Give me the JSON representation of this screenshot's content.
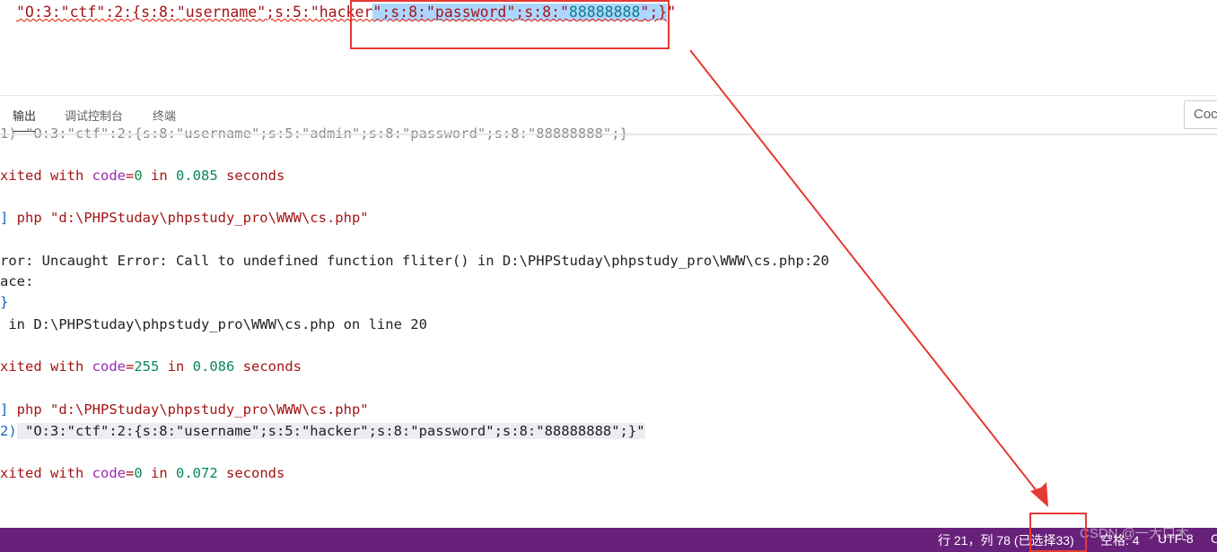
{
  "editor": {
    "line_prefix": "\"O:3:\"ctf\":2:{s:8:\"username\";s:5:\"hacker",
    "line_sel_a": "\";s:8:\"password\";s:8:\"",
    "line_sel_b": "88888888",
    "line_sel_c": "\";}",
    "line_end": "\""
  },
  "panel": {
    "tabs": [
      "输出",
      "调试控制台",
      "终端"
    ],
    "active_tab": "输出",
    "output_select_label": "Coc"
  },
  "output": {
    "lines": [
      "1) \"O:3:\"ctf\":2:{s:8:\"username\";s:5:\"admin\";s:8:\"password\";s:8:\"88888888\";}",
      "xited with code=0 in 0.085 seconds",
      "] php \"d:\\PHPStuday\\phpstudy_pro\\WWW\\cs.php\"",
      "ror: Uncaught Error: Call to undefined function fliter() in D:\\PHPStuday\\phpstudy_pro\\WWW\\cs.php:20",
      "ace:",
      "}",
      " in D:\\PHPStuday\\phpstudy_pro\\WWW\\cs.php on line 20",
      "xited with code=255 in 0.086 seconds",
      "] php \"d:\\PHPStuday\\phpstudy_pro\\WWW\\cs.php\"",
      "2) \"O:3:\"ctf\":2:{s:8:\"username\";s:5:\"hacker\";s:8:\"password\";s:8:\"88888888\";}\"",
      "xited with code=0 in 0.072 seconds"
    ],
    "exit_parts": [
      {
        "a": "xited with ",
        "b": "code",
        "c": "=",
        "d": "0",
        "e": " in ",
        "f": "0.085",
        "g": " seconds"
      },
      {
        "a": "xited with ",
        "b": "code",
        "c": "=",
        "d": "255",
        "e": " in ",
        "f": "0.086",
        "g": " seconds"
      },
      {
        "a": "xited with ",
        "b": "code",
        "c": "=",
        "d": "0",
        "e": " in ",
        "f": "0.072",
        "g": " seconds"
      }
    ],
    "cmd_bracket": "]",
    "cmd_text": " php \"d:\\PHPStuday\\phpstudy_pro\\WWW\\cs.php\"",
    "result_prefix": "2)",
    "result_text": " \"O:3:\"ctf\":2:{s:8:\"username\";s:5:\"hacker\";s:8:\"password\";s:8:\"88888888\";}\""
  },
  "status": {
    "position": "行 21，列 78 (已选择33)",
    "spaces": "空格: 4",
    "encoding": "UTF-8",
    "more": "C",
    "watermark": "CSDN @一大口木"
  },
  "colors": {
    "status_bg": "#68217a",
    "annotation_red": "#e53935",
    "selection": "#add6ff"
  }
}
